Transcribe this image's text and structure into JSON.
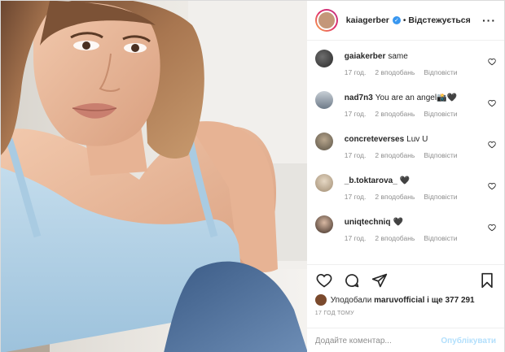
{
  "header": {
    "username": "kaiagerber",
    "separator": "•",
    "follow_label": "Відстежується",
    "more_label": "···"
  },
  "comments": [
    {
      "user": "gaiakerber",
      "text": "same",
      "time": "17 год.",
      "likes": "2 вподобань",
      "reply": "Відповісти"
    },
    {
      "user": "nad7n3",
      "text": "You are an angel📸🖤",
      "time": "17 год.",
      "likes": "2 вподобань",
      "reply": "Відповісти"
    },
    {
      "user": "concreteverses",
      "text": "Luv U",
      "time": "17 год.",
      "likes": "2 вподобань",
      "reply": "Відповісти"
    },
    {
      "user": "_b.toktarova_",
      "text": "🖤",
      "time": "17 год.",
      "likes": "2 вподобань",
      "reply": "Відповісти"
    },
    {
      "user": "uniqtechniq",
      "text": "🖤",
      "time": "17 год.",
      "likes": "2 вподобань",
      "reply": "Відповісти"
    }
  ],
  "likes": {
    "prefix": "Уподобали",
    "user": "maruvofficial",
    "suffix": "і ще 377 291"
  },
  "posted_time": "17 год тому",
  "comment_input": {
    "placeholder": "Додайте коментар...",
    "publish_label": "Опублікувати"
  },
  "icons": [
    "heart-icon",
    "comment-icon",
    "share-icon",
    "bookmark-icon",
    "verified-icon",
    "more-icon"
  ],
  "colors": {
    "verified": "#3897f0",
    "publish_disabled": "#b2dffc",
    "meta_gray": "#8e8e8e"
  }
}
